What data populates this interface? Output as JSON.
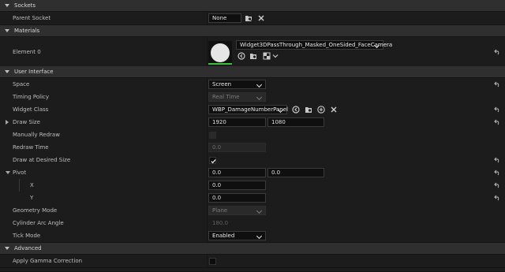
{
  "sockets": {
    "title": "Sockets",
    "parent_socket": {
      "label": "Parent Socket",
      "value": "None"
    }
  },
  "materials": {
    "title": "Materials",
    "element0": {
      "label": "Element 0",
      "value": "Widget3DPassThrough_Masked_OneSided_FaceCamera"
    }
  },
  "user_interface": {
    "title": "User Interface",
    "space": {
      "label": "Space",
      "value": "Screen"
    },
    "timing_policy": {
      "label": "Timing Policy",
      "value": "Real Time"
    },
    "widget_class": {
      "label": "Widget Class",
      "value": "WBP_DamageNumberPanel"
    },
    "draw_size": {
      "label": "Draw Size",
      "x": "1920",
      "y": "1080"
    },
    "manually_redraw": {
      "label": "Manually Redraw",
      "checked": false
    },
    "redraw_time": {
      "label": "Redraw Time",
      "value": "0.0"
    },
    "draw_at_desired_size": {
      "label": "Draw at Desired Size",
      "checked": true
    },
    "pivot": {
      "label": "Pivot",
      "x": "0.0",
      "y": "0.0",
      "x_label": "X",
      "x_value": "0.0",
      "y_label": "Y",
      "y_value": "0.0"
    },
    "geometry_mode": {
      "label": "Geometry Mode",
      "value": "Plane"
    },
    "cylinder_arc_angle": {
      "label": "Cylinder Arc Angle",
      "value": "180.0"
    },
    "tick_mode": {
      "label": "Tick Mode",
      "value": "Enabled"
    }
  },
  "advanced": {
    "title": "Advanced",
    "apply_gamma": {
      "label": "Apply Gamma Correction",
      "checked": false
    }
  },
  "icons": {
    "collapse": "triangle-down-icon",
    "reset": "reset-arrow-icon",
    "browse": "browse-folder-icon",
    "clear": "close-icon",
    "use_selected": "use-selected-arrow-icon",
    "add": "add-plus-icon"
  }
}
